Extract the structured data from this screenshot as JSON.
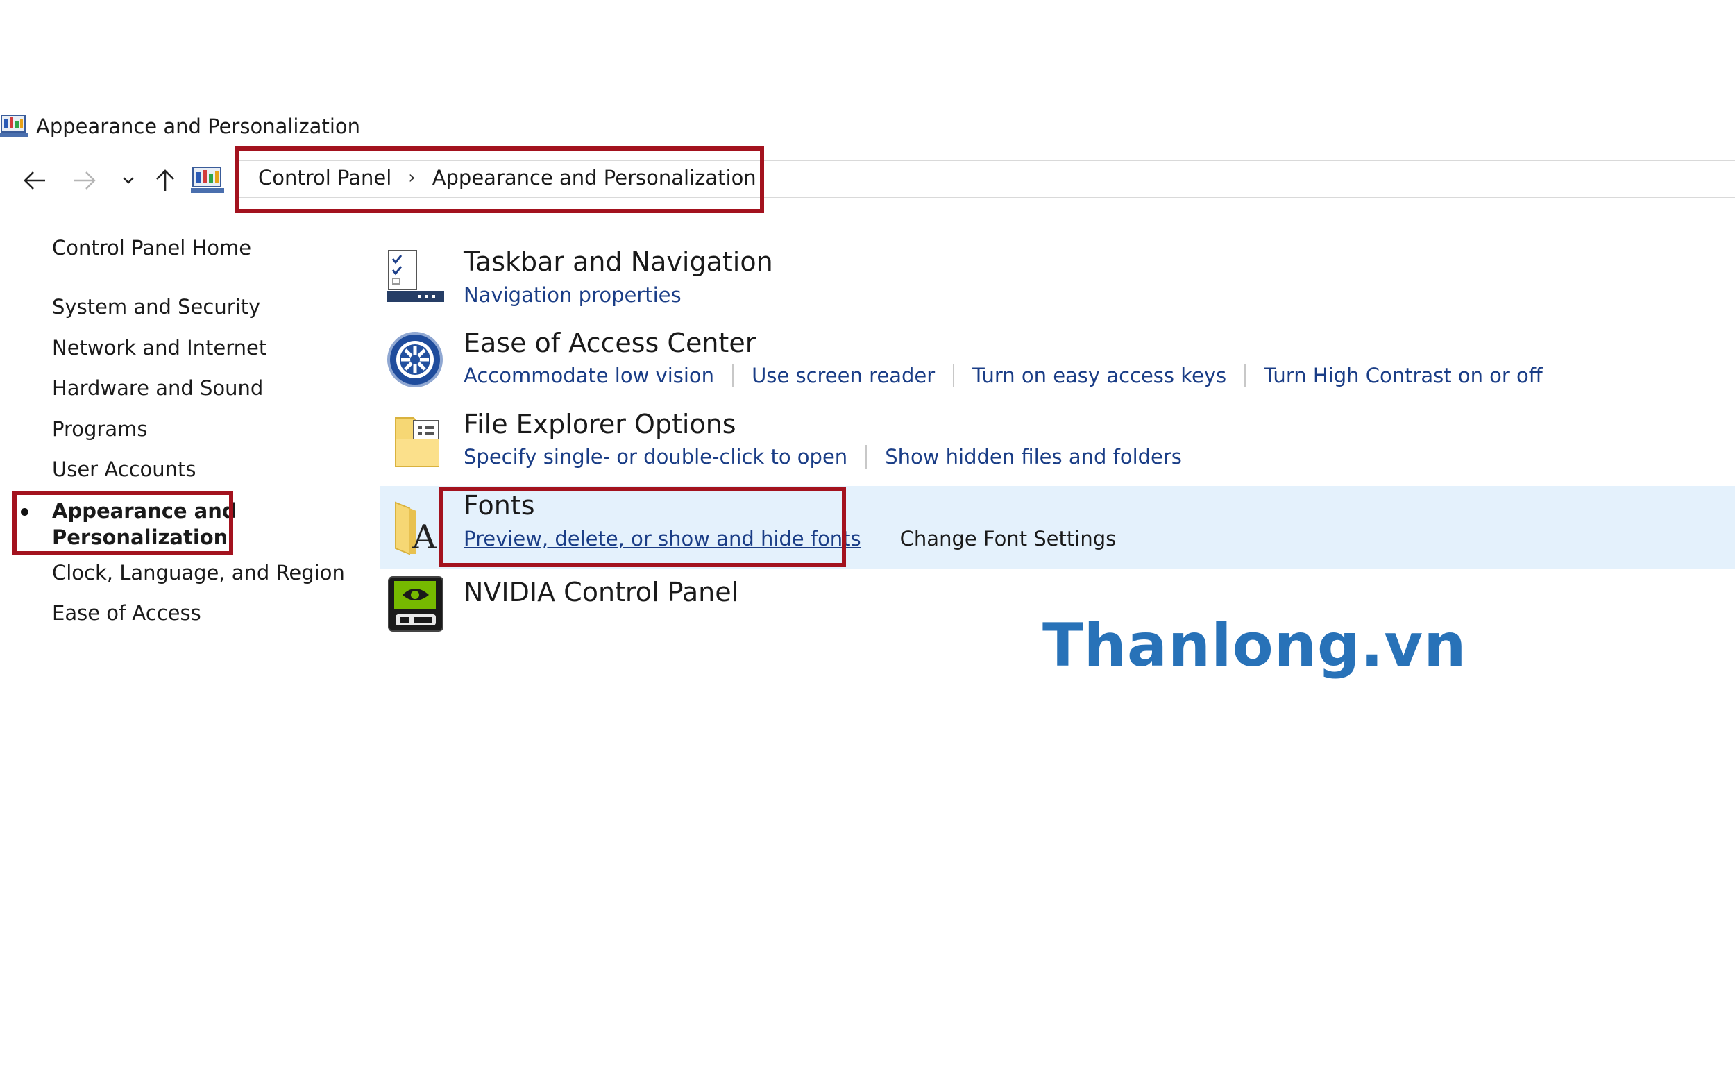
{
  "window": {
    "title": "Appearance and Personalization"
  },
  "navigation": {
    "back": "back-arrow",
    "forward": "forward-arrow",
    "recent": "chevron-down",
    "up": "up-arrow",
    "breadcrumb": [
      "Control Panel",
      "Appearance and Personalization"
    ],
    "separator": "›"
  },
  "sidebar": {
    "home": "Control Panel Home",
    "items": [
      "System and Security",
      "Network and Internet",
      "Hardware and Sound",
      "Programs",
      "User Accounts",
      "Appearance and Personalization",
      "Clock, Language, and Region",
      "Ease of Access"
    ],
    "current_line1": "Appearance and",
    "current_line2": "Personalization"
  },
  "categories": [
    {
      "title": "Taskbar and Navigation",
      "links": [
        "Navigation properties"
      ],
      "icon": "taskbar-icon"
    },
    {
      "title": "Ease of Access Center",
      "links": [
        "Accommodate low vision",
        "Use screen reader",
        "Turn on easy access keys",
        "Turn High Contrast on or off"
      ],
      "icon": "ease-of-access-icon"
    },
    {
      "title": "File Explorer Options",
      "links": [
        "Specify single- or double-click to open",
        "Show hidden files and folders"
      ],
      "icon": "folder-options-icon"
    },
    {
      "title": "Fonts",
      "links": [
        "Preview, delete, or show and hide fonts",
        "Change Font Settings"
      ],
      "icon": "fonts-folder-icon"
    },
    {
      "title": "NVIDIA Control Panel",
      "links": [],
      "icon": "nvidia-icon"
    }
  ],
  "watermark": "Thanlong.vn",
  "colors": {
    "highlight": "#a3121e",
    "link": "#1a3d86",
    "hover_row": "#e4f1fc",
    "watermark": "#2872b8"
  }
}
